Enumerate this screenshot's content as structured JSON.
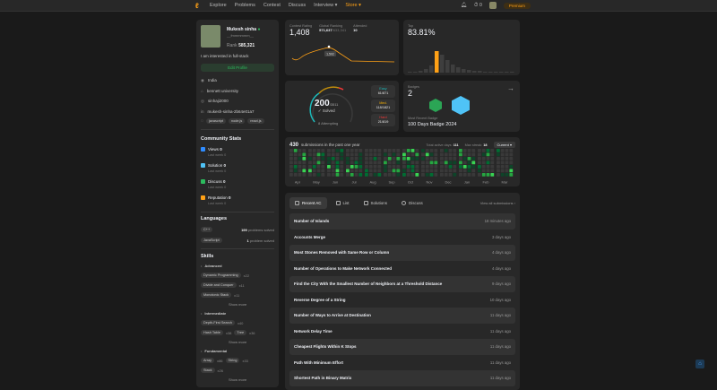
{
  "nav": {
    "links": [
      "Explore",
      "Problems",
      "Contest",
      "Discuss",
      "Interview ▾"
    ],
    "store": "Store ▾",
    "notif": "0",
    "premium": "Premium"
  },
  "profile": {
    "name": "Mukesh sinha",
    "handle": "__fmmmmmm__",
    "rank_label": "Rank",
    "rank": "585,321",
    "bio": "I am interested in full-stack",
    "edit": "Edit Profile",
    "location": "India",
    "school": "bennett university",
    "github": "sinhaji2000",
    "linkedin": "mukesh-sinha-2b64e01a7",
    "tags": [
      "javascript",
      "node.js",
      "react.js"
    ]
  },
  "community": {
    "title": "Community Stats",
    "items": [
      {
        "label": "Views",
        "value": "0",
        "color": "#2f8cff"
      },
      {
        "label": "Solution",
        "value": "0",
        "color": "#4fc3f7"
      },
      {
        "label": "Discuss",
        "value": "0",
        "color": "#2cbb5d"
      },
      {
        "label": "Reputation",
        "value": "0",
        "color": "#ffa116"
      }
    ],
    "last_week": "Last week 0"
  },
  "languages": {
    "title": "Languages",
    "items": [
      {
        "name": "C++",
        "count": "199",
        "suffix": "problems solved"
      },
      {
        "name": "JavaScript",
        "count": "1",
        "suffix": "problem solved"
      }
    ]
  },
  "skills": {
    "title": "Skills",
    "groups": [
      {
        "name": "Advanced",
        "items": [
          {
            "t": "Dynamic Programming",
            "c": "x22"
          },
          {
            "t": "Divide and Conquer",
            "c": "x11"
          },
          {
            "t": "Monotonic Stack",
            "c": "x11"
          }
        ]
      },
      {
        "name": "Intermediate",
        "items": [
          {
            "t": "Depth-First Search",
            "c": "x40"
          },
          {
            "t": "Hash Table",
            "c": "x38"
          },
          {
            "t": "Tree",
            "c": "x36"
          }
        ]
      },
      {
        "name": "Fundamental",
        "items": [
          {
            "t": "Array",
            "c": "x86"
          },
          {
            "t": "String",
            "c": "x33"
          },
          {
            "t": "Stack",
            "c": "x26"
          }
        ]
      }
    ],
    "show_more": "Show more"
  },
  "contest": {
    "rating_label": "Contest Rating",
    "rating": "1,408",
    "global_label": "Global Ranking",
    "global": "571,637",
    "global_total": "/633,341",
    "attended_label": "Attended",
    "attended": "10",
    "tooltip": "1,502",
    "top_label": "Top",
    "top": "83.81%"
  },
  "solved": {
    "count": "200",
    "total": "/3511",
    "label": "Solved",
    "attempting": "8 Attempting",
    "easy": {
      "label": "Easy",
      "v": "61/871"
    },
    "med": {
      "label": "Med.",
      "v": "118/1821"
    },
    "hard": {
      "label": "Hard",
      "v": "21/819"
    }
  },
  "badges": {
    "label": "Badges",
    "count": "2",
    "recent_label": "Most Recent Badge",
    "recent": "100 Days Badge 2024"
  },
  "heatmap": {
    "count": "430",
    "text": "submissions in the past one year",
    "active_label": "Total active days:",
    "active": "111",
    "streak_label": "Max streak:",
    "streak": "18",
    "select": "Current",
    "months": [
      "Apr",
      "May",
      "Jun",
      "Jul",
      "Aug",
      "Sep",
      "Oct",
      "Nov",
      "Dec",
      "Jan",
      "Feb",
      "Mar"
    ]
  },
  "recent": {
    "tabs": [
      "Recent AC",
      "List",
      "Solutions",
      "Discuss"
    ],
    "view_all": "View all submissions ›",
    "rows": [
      {
        "t": "Number of Islands",
        "d": "18 minutes ago"
      },
      {
        "t": "Accounts Merge",
        "d": "3 days ago"
      },
      {
        "t": "Most Stones Removed with Same Row or Column",
        "d": "4 days ago"
      },
      {
        "t": "Number of Operations to Make Network Connected",
        "d": "4 days ago"
      },
      {
        "t": "Find the City With the Smallest Number of Neighbors at a Threshold Distance",
        "d": "9 days ago"
      },
      {
        "t": "Reverse Degree of a String",
        "d": "10 days ago"
      },
      {
        "t": "Number of Ways to Arrive at Destination",
        "d": "11 days ago"
      },
      {
        "t": "Network Delay Time",
        "d": "11 days ago"
      },
      {
        "t": "Cheapest Flights Within K Stops",
        "d": "11 days ago"
      },
      {
        "t": "Path With Minimum Effort",
        "d": "11 days ago"
      },
      {
        "t": "Shortest Path in Binary Matrix",
        "d": "11 days ago"
      }
    ]
  }
}
